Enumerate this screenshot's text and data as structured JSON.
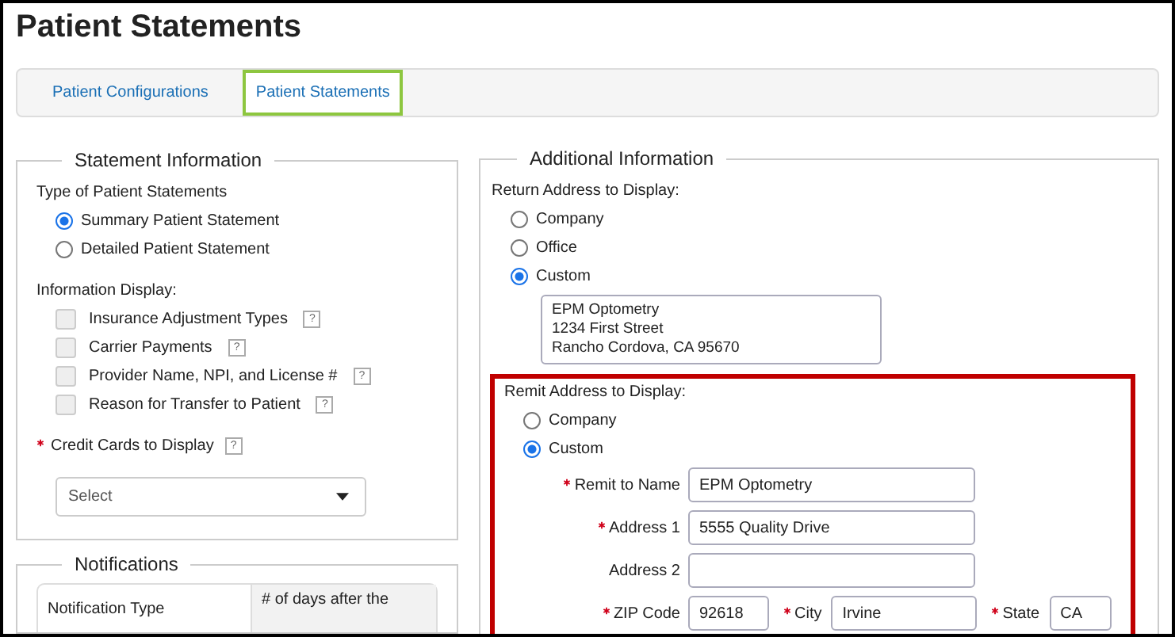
{
  "page_title": "Patient Statements",
  "tabs": [
    {
      "label": "Patient Configurations",
      "selected": false
    },
    {
      "label": "Patient Statements",
      "selected": true
    }
  ],
  "statement_information": {
    "legend": "Statement Information",
    "type_label": "Type of Patient Statements",
    "types": [
      {
        "label": "Summary Patient Statement",
        "selected": true
      },
      {
        "label": "Detailed Patient Statement",
        "selected": false
      }
    ],
    "display_label": "Information Display:",
    "display_options": [
      {
        "label": "Insurance Adjustment Types",
        "checked": false,
        "disabled": true,
        "help": "?"
      },
      {
        "label": "Carrier Payments",
        "checked": false,
        "disabled": true,
        "help": "?"
      },
      {
        "label": "Provider Name, NPI, and License #",
        "checked": false,
        "disabled": true,
        "help": "?"
      },
      {
        "label": "Reason for Transfer to Patient",
        "checked": false,
        "disabled": true,
        "help": "?"
      }
    ],
    "credit_cards": {
      "label": "Credit Cards to Display",
      "required": true,
      "help": "?",
      "placeholder": "Select"
    }
  },
  "notifications": {
    "legend": "Notifications",
    "columns": [
      "Notification Type",
      "# of days after the"
    ]
  },
  "additional_information": {
    "legend": "Additional Information",
    "return_label": "Return Address to Display:",
    "return_options": [
      {
        "label": "Company",
        "selected": false
      },
      {
        "label": "Office",
        "selected": false
      },
      {
        "label": "Custom",
        "selected": true
      }
    ],
    "return_custom_lines": [
      "EPM Optometry",
      "1234 First Street",
      "Rancho Cordova, CA 95670"
    ],
    "remit": {
      "highlighted": true,
      "label": "Remit Address to Display:",
      "options": [
        {
          "label": "Company",
          "selected": false
        },
        {
          "label": "Custom",
          "selected": true
        }
      ],
      "fields": [
        {
          "label": "Remit to Name",
          "required": true,
          "value": "EPM Optometry"
        },
        {
          "label": "Address 1",
          "required": true,
          "value": "5555 Quality Drive"
        },
        {
          "label": "Address 2",
          "required": false
        }
      ],
      "zip": {
        "label": "ZIP Code",
        "required": true,
        "value": "92618"
      },
      "city": {
        "label": "City",
        "required": true,
        "value": "Irvine"
      },
      "state": {
        "label": "State",
        "required": true,
        "value": "CA"
      }
    }
  }
}
